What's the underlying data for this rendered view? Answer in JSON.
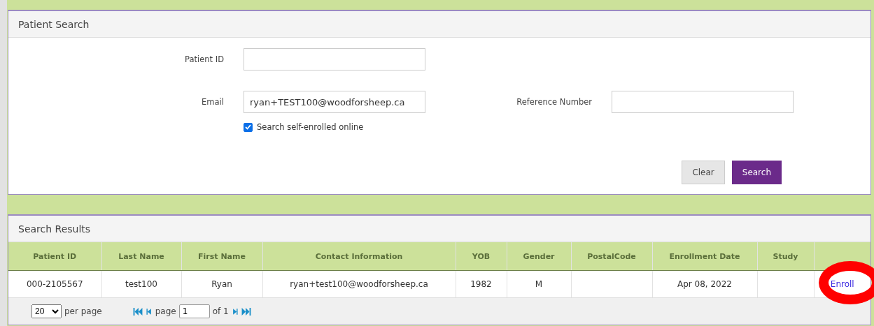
{
  "search_panel": {
    "title": "Patient Search",
    "fields": [
      {
        "label": "Patient ID"
      },
      {
        "label": "Email",
        "value": "ryan+TEST100@woodforsheep.ca"
      },
      {
        "label": "Reference Number"
      }
    ],
    "self_enrolled": {
      "label": "Search self-enrolled online",
      "checked": true
    },
    "buttons": [
      {
        "label": "Clear",
        "kind": "secondary"
      },
      {
        "label": "Search",
        "kind": "primary"
      }
    ]
  },
  "results_panel": {
    "title": "Search Results",
    "table": {
      "columns": [
        "Patient ID",
        "Last Name",
        "First Name",
        "Contact Information",
        "YOB",
        "Gender",
        "PostalCode",
        "Enrollment Date",
        "Study"
      ],
      "rows": [
        {
          "cells": [
            "000-2105567",
            "test100",
            "Ryan",
            "ryan+test100@woodforsheep.ca",
            "1982",
            "M",
            "",
            "Apr 08, 2022",
            ""
          ],
          "action": "Enroll",
          "action_circled": true
        }
      ]
    },
    "pager": {
      "page_size": "20",
      "per_page": "per page",
      "page_label": "page",
      "page": "1",
      "of": "of 1"
    }
  }
}
